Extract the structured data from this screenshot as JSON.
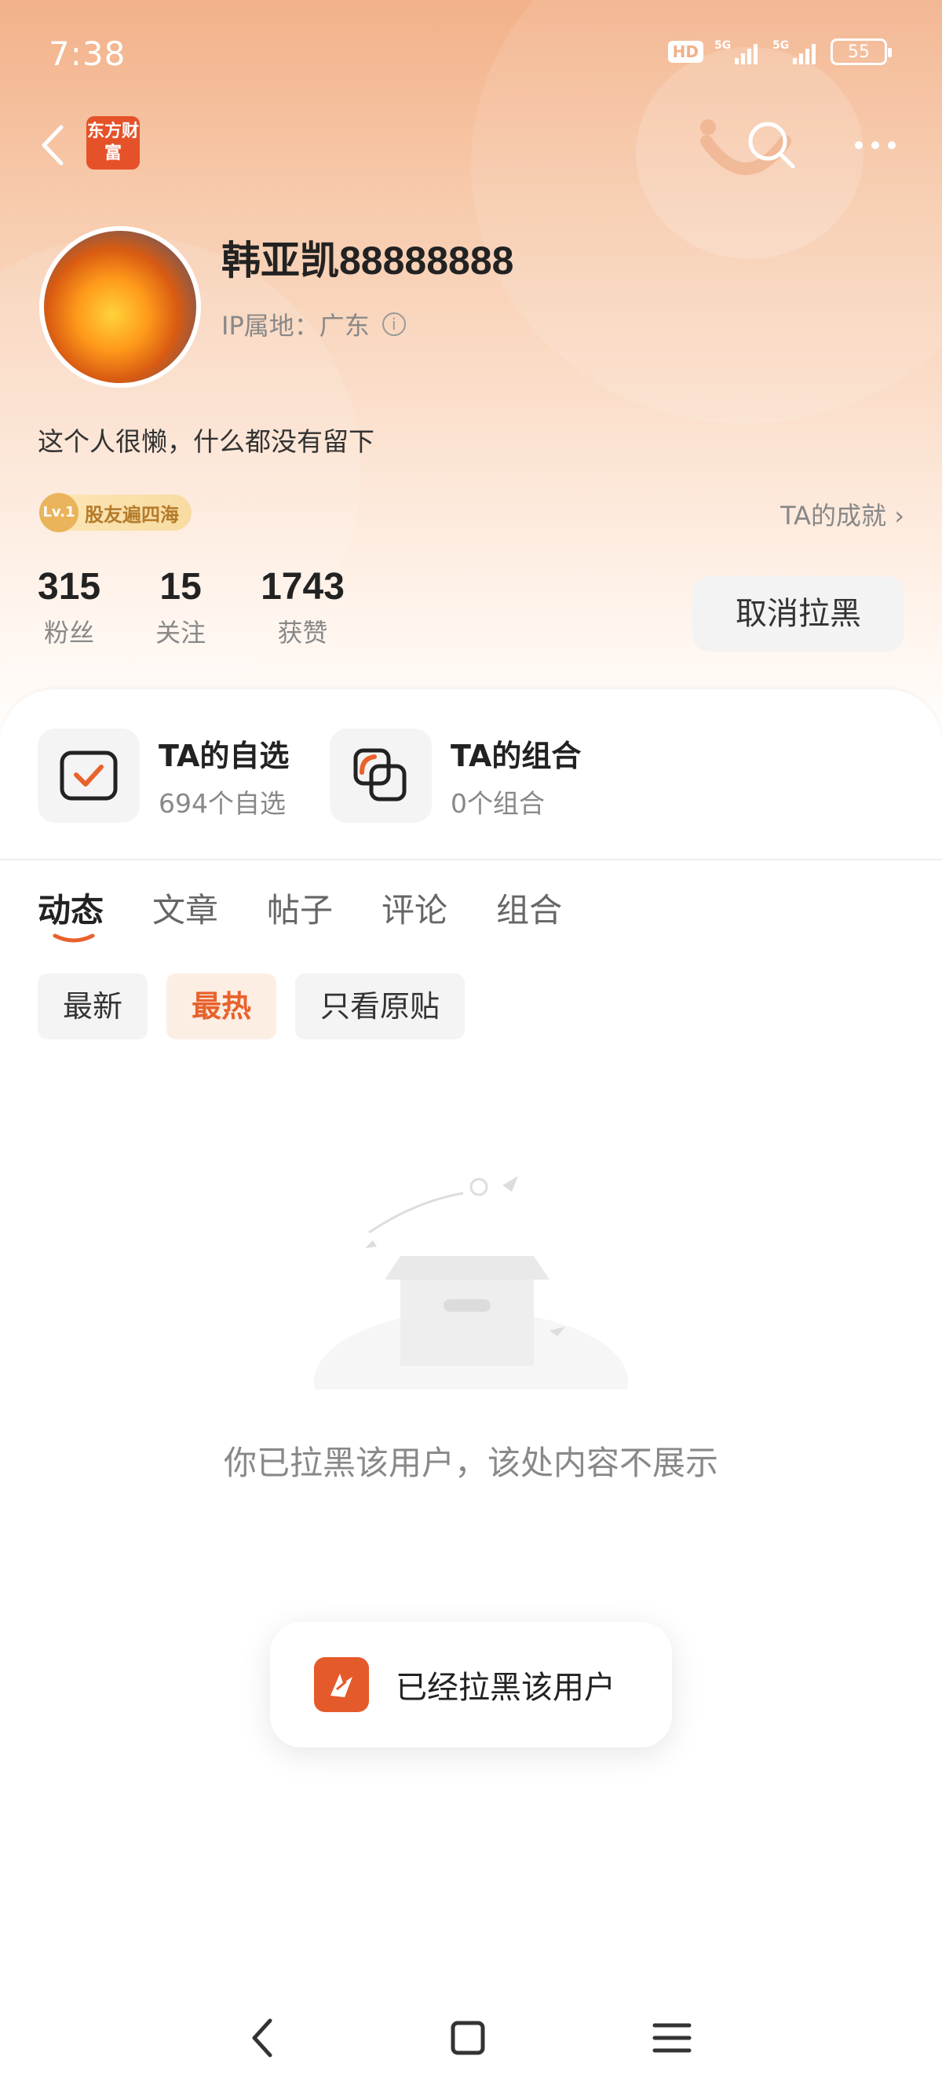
{
  "status_bar": {
    "time": "7:38",
    "hd": "HD",
    "net1": "5G",
    "net2": "5G",
    "battery": "55"
  },
  "nav": {
    "logo_text": "东方财富"
  },
  "profile": {
    "username": "韩亚凯88888888",
    "ip_label": "IP属地：广东",
    "bio": "这个人很懒，什么都没有留下",
    "level_icon": "Lv.1",
    "level_name": "股友遍四海",
    "achievement_link": "TA的成就"
  },
  "stats": [
    {
      "value": "315",
      "label": "粉丝"
    },
    {
      "value": "15",
      "label": "关注"
    },
    {
      "value": "1743",
      "label": "获赞"
    }
  ],
  "unblock_button": "取消拉黑",
  "shortcuts": [
    {
      "title": "TA的自选",
      "subtitle": "694个自选",
      "icon": "checkbox-icon"
    },
    {
      "title": "TA的组合",
      "subtitle": "0个组合",
      "icon": "portfolio-icon"
    }
  ],
  "tabs": [
    "动态",
    "文章",
    "帖子",
    "评论",
    "组合"
  ],
  "active_tab": "动态",
  "filters": [
    "最新",
    "最热",
    "只看原贴"
  ],
  "active_filter": "最热",
  "empty_message": "你已拉黑该用户，该处内容不展示",
  "toast": {
    "text": "已经拉黑该用户",
    "icon": "app-logo-icon"
  },
  "colors": {
    "accent": "#e8622c",
    "header_gradient_top": "#f2b189"
  }
}
